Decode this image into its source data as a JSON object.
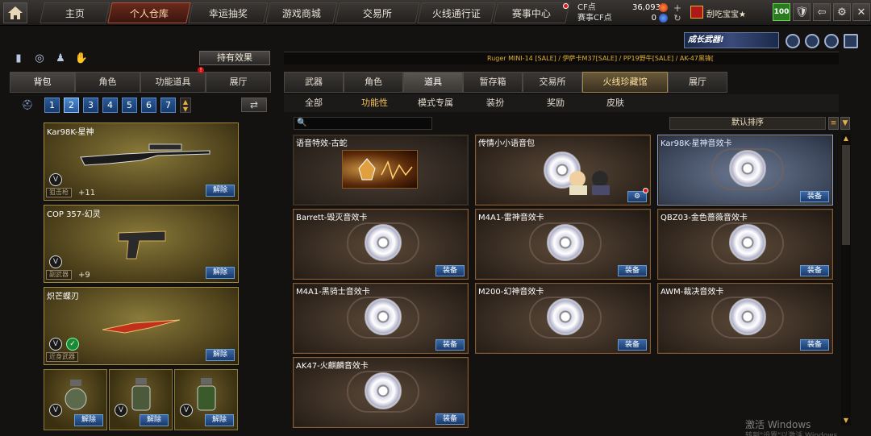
{
  "nav": {
    "tabs": [
      "主页",
      "个人仓库",
      "幸运抽奖",
      "游戏商城",
      "交易所",
      "火线通行证",
      "赛事中心"
    ],
    "active_index": 1
  },
  "account": {
    "cf_label": "CF点",
    "cf_value": "36,093",
    "game_cf_label": "赛事CF点",
    "game_cf_value": "0",
    "username": "刮吃宝宝★",
    "level": "100"
  },
  "promo": {
    "text": "成长武器!"
  },
  "left": {
    "effect_button": "持有效果",
    "tabs": [
      "背包",
      "角色",
      "功能道具",
      "展厅"
    ],
    "pages": [
      "1",
      "2",
      "3",
      "4",
      "5",
      "6",
      "7"
    ],
    "active_page": "2",
    "weapons": [
      {
        "name": "Kar98K-星神",
        "type": "狙击枪",
        "bonus": "+11",
        "action": "解除"
      },
      {
        "name": "COP 357-幻灵",
        "type": "副武器",
        "bonus": "+9",
        "action": "解除"
      },
      {
        "name": "炽芒蝶刃",
        "type": "近身武器",
        "bonus": "",
        "action": "解除"
      }
    ],
    "grenades": [
      {
        "action": "解除"
      },
      {
        "action": "解除"
      },
      {
        "action": "解除"
      }
    ]
  },
  "ticker": "Ruger MINI-14  [SALE] / 伊萨卡M37[SALE] / PP19野牛[SALE] / AK-47黑锋[",
  "right": {
    "tabs": [
      "武器",
      "角色",
      "道具",
      "暂存箱",
      "交易所",
      "火线珍藏馆",
      "展厅"
    ],
    "active_tab": "道具",
    "subtabs": [
      "全部",
      "功能性",
      "模式专属",
      "装扮",
      "奖励",
      "皮肤"
    ],
    "active_subtab": "功能性",
    "sort_label": "默认排序",
    "items": [
      {
        "name": "语音特效-古蛇",
        "action": ""
      },
      {
        "name": "传情小小语音包",
        "action": ""
      },
      {
        "name": "Kar98K-星神音效卡",
        "action": "装备"
      },
      {
        "name": "Barrett-毁灭音效卡",
        "action": "装备"
      },
      {
        "name": "M4A1-雷神音效卡",
        "action": "装备"
      },
      {
        "name": "QBZ03-金色蔷薇音效卡",
        "action": "装备"
      },
      {
        "name": "M4A1-黑骑士音效卡",
        "action": "装备"
      },
      {
        "name": "M200-幻神音效卡",
        "action": "装备"
      },
      {
        "name": "AWM-裁决音效卡",
        "action": "装备"
      },
      {
        "name": "AK47-火麒麟音效卡",
        "action": "装备"
      }
    ]
  },
  "watermark": {
    "line1": "激活 Windows",
    "line2": "转到\"设置\"以激活 Windows"
  },
  "icons": [
    "home-icon",
    "gift-icon",
    "arrow-exit-icon",
    "gear-icon",
    "close-icon",
    "search-icon",
    "disc-icon"
  ]
}
